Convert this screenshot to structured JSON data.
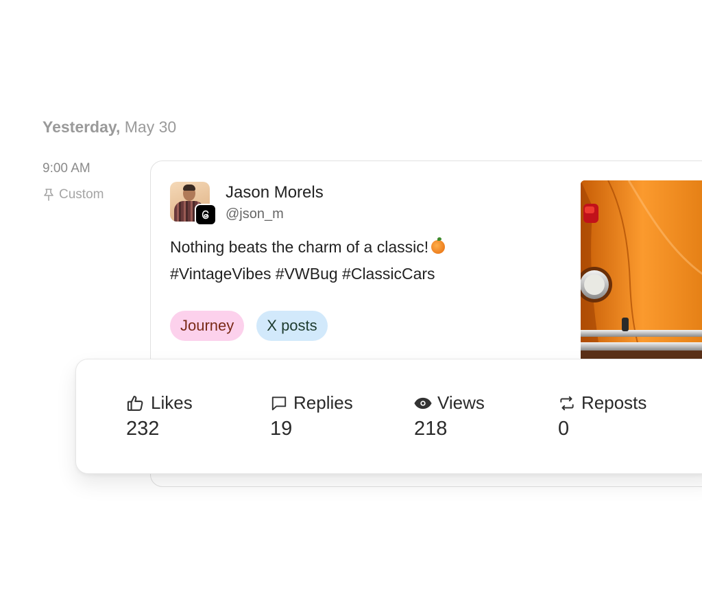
{
  "schedule": {
    "day_label": "Yesterday,",
    "date_label": "May 30",
    "time": "9:00 AM",
    "custom_label": "Custom"
  },
  "post": {
    "author_name": "Jason Morels",
    "author_handle": "@json_m",
    "text_line1": "Nothing beats the charm of a classic!",
    "text_line2": "#VintageVibes #VWBug #ClassicCars",
    "tags": [
      {
        "label": "Journey"
      },
      {
        "label": "X posts"
      }
    ],
    "platform_icon": "threads-icon",
    "image_icon": "orange-vw-bug-photo"
  },
  "metrics": [
    {
      "label": "Likes",
      "value": "232",
      "icon": "thumbs-up-icon"
    },
    {
      "label": "Replies",
      "value": "19",
      "icon": "comment-icon"
    },
    {
      "label": "Views",
      "value": "218",
      "icon": "eye-icon"
    },
    {
      "label": "Reposts",
      "value": "0",
      "icon": "repost-icon"
    }
  ],
  "colors": {
    "tag_journey_bg": "#fcd1ec",
    "tag_journey_text": "#7a2a17",
    "tag_x_bg": "#d2e9fb",
    "tag_x_text": "#1d3b2e"
  }
}
